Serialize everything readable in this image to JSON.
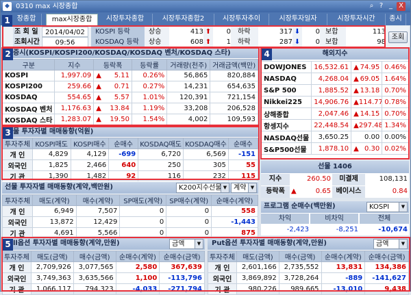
{
  "window": {
    "title": "0310 max 시장종합",
    "controls": [
      "⌕",
      "?",
      "_",
      "X"
    ]
  },
  "tabs": [
    "장종합",
    "max시장종합",
    "시장투자종합",
    "시장투자종합2",
    "시장투자추이",
    "시장투자일자",
    "시장투자시간",
    "종시"
  ],
  "top": {
    "date_label": "조 회 일",
    "date_value": "2014/04/02",
    "time_label": "조회시간",
    "time_value": "09:56",
    "kospi_label": "KOSPI 등락",
    "kosdaq_label": "KOSDAQ 등락",
    "kospi": {
      "up_label": "상승",
      "up": "413",
      "up_limit": "0",
      "down_label": "하락",
      "down": "317",
      "down_limit": "0",
      "flat_label": "보합",
      "flat": "113"
    },
    "kosdaq": {
      "up_label": "상승",
      "up": "608",
      "up_limit": "1",
      "down_label": "하락",
      "down": "287",
      "down_limit": "0",
      "flat_label": "보합",
      "flat": "98"
    },
    "query_button": "조회"
  },
  "s2": {
    "title": "증시(KOSPI/KOSPI200/KOSDAQ/KOSDAQ 벤처/KOSDAQ 스타)",
    "headers": [
      "구분",
      "지수",
      "등락폭",
      "등락률",
      "거래량(천주)",
      "거래금액(백만)"
    ],
    "rows": [
      {
        "name": "KOSPI",
        "index": "1,997.09",
        "dir": "▲",
        "chg": "5.11",
        "rate": "0.26%",
        "vol": "56,865",
        "amt": "820,884"
      },
      {
        "name": "KOSPI200",
        "index": "259.66",
        "dir": "▲",
        "chg": "0.71",
        "rate": "0.27%",
        "vol": "14,231",
        "amt": "654,635"
      },
      {
        "name": "KOSDAQ",
        "index": "554.65",
        "dir": "▲",
        "chg": "5.57",
        "rate": "1.01%",
        "vol": "120,391",
        "amt": "721,154"
      },
      {
        "name": "KOSDAQ 벤처",
        "index": "1,176.63",
        "dir": "▲",
        "chg": "13.84",
        "rate": "1.19%",
        "vol": "33,208",
        "amt": "206,528"
      },
      {
        "name": "KOSDAQ 스타",
        "index": "1,283.07",
        "dir": "▲",
        "chg": "19.50",
        "rate": "1.54%",
        "vol": "4,002",
        "amt": "109,593"
      }
    ]
  },
  "s3": {
    "title": "물 투자자별 매매동향(억원)",
    "headers": [
      "투자주체",
      "KOSPI매도",
      "KOSPI매수",
      "순매수",
      "KOSDAQ매도",
      "KOSDAQ매수",
      "순매수"
    ],
    "rows": [
      {
        "name": "개 인",
        "a": "4,829",
        "b": "4,129",
        "net1": "-699",
        "c": "6,720",
        "d": "6,569",
        "net2": "-151"
      },
      {
        "name": "외국인",
        "a": "1,825",
        "b": "2,466",
        "net1": "640",
        "c": "250",
        "d": "305",
        "net2": "55"
      },
      {
        "name": "기 관",
        "a": "1,390",
        "b": "1,482",
        "net1": "92",
        "c": "116",
        "d": "232",
        "net2": "115"
      }
    ]
  },
  "fut": {
    "title": "선물 투자자별 매매동향(계약,백만원)",
    "select1": "K200지수선물",
    "select2": "계약",
    "headers": [
      "투자주체",
      "매도(계약)",
      "매수(계약)",
      "SP매도(계약)",
      "SP매수(계약)",
      "순매수(계약)"
    ],
    "rows": [
      {
        "name": "개 인",
        "a": "6,949",
        "b": "7,507",
        "c": "0",
        "d": "0",
        "net": "558"
      },
      {
        "name": "외국인",
        "a": "13,872",
        "b": "12,429",
        "c": "0",
        "d": "0",
        "net": "-1,443"
      },
      {
        "name": "기 관",
        "a": "4,691",
        "b": "5,566",
        "c": "0",
        "d": "0",
        "net": "875"
      }
    ]
  },
  "s4": {
    "title": "해외지수",
    "rows": [
      {
        "name": "DOWJONES",
        "val": "16,532.61",
        "dir": "▲",
        "chg": "74.95",
        "rate": "0.46%"
      },
      {
        "name": "NASDAQ",
        "val": "4,268.04",
        "dir": "▲",
        "chg": "69.05",
        "rate": "1.64%"
      },
      {
        "name": "S&P 500",
        "val": "1,885.52",
        "dir": "▲",
        "chg": "13.18",
        "rate": "0.70%"
      },
      {
        "name": "Nikkei225",
        "val": "14,906.76",
        "dir": "▲",
        "chg": "114.77",
        "rate": "0.78%"
      },
      {
        "name": "상해종합",
        "val": "2,047.46",
        "dir": "▲",
        "chg": "14.15",
        "rate": "0.70%"
      },
      {
        "name": "항셍지수",
        "val": "22,448.54",
        "dir": "▲",
        "chg": "297.48",
        "rate": "1.34%"
      },
      {
        "name": "NASDAQ선물",
        "val": "3,650.25",
        "dir": "",
        "chg": "0.00",
        "rate": "0.00%"
      },
      {
        "name": "S&P500선물",
        "val": "1,878.10",
        "dir": "▲",
        "chg": "0.30",
        "rate": "0.02%"
      }
    ]
  },
  "fut1406": {
    "title": "선물 1406",
    "index_label": "지수",
    "index": "260.50",
    "oi_label": "미결제",
    "oi": "108,131",
    "chg_label": "등락폭",
    "dir": "▲",
    "chg": "0.65",
    "basis_label": "베이시스",
    "basis": "0.84"
  },
  "prog": {
    "title": "프로그램 순매수(백만원)",
    "select": "KOSPI",
    "headers": [
      "차익",
      "비차익",
      "전체"
    ],
    "values": [
      "-2,423",
      "-8,251",
      "-10,674"
    ]
  },
  "call": {
    "title": "ll옵션 투자자별 매매동향(계약,만원)",
    "select": "금액",
    "headers": [
      "투자주체",
      "매도(금액)",
      "매수(금액)",
      "순매수(계약)",
      "순매수(금액)"
    ],
    "rows": [
      {
        "name": "개 인",
        "a": "2,709,926",
        "b": "3,077,565",
        "c": "2,580",
        "d": "367,639"
      },
      {
        "name": "외국인",
        "a": "3,749,363",
        "b": "3,635,566",
        "c": "1,100",
        "d": "-113,796"
      },
      {
        "name": "기 관",
        "a": "1,066,117",
        "b": "794,323",
        "c": "-4,033",
        "d": "-271,794"
      }
    ]
  },
  "put": {
    "title": "Put옵션 투자자별 매매동향(계약,만원)",
    "select": "금액",
    "headers": [
      "투자주체",
      "매도(금액)",
      "매수(금액)",
      "순매수(계약)",
      "순매수(금액)"
    ],
    "rows": [
      {
        "name": "개 인",
        "a": "2,601,166",
        "b": "2,735,552",
        "c": "13,831",
        "d": "134,386"
      },
      {
        "name": "외국인",
        "a": "3,869,892",
        "b": "3,728,264",
        "c": "-889",
        "d": "-141,627"
      },
      {
        "name": "기 관",
        "a": "980,226",
        "b": "989,665",
        "c": "-13,010",
        "d": "9,438"
      }
    ]
  },
  "badges": [
    "1",
    "2",
    "3",
    "4",
    "5"
  ],
  "colors": {
    "accent": "#e8303a",
    "up": "#d40000",
    "down": "#0030d0",
    "title": "#3e67a6"
  }
}
